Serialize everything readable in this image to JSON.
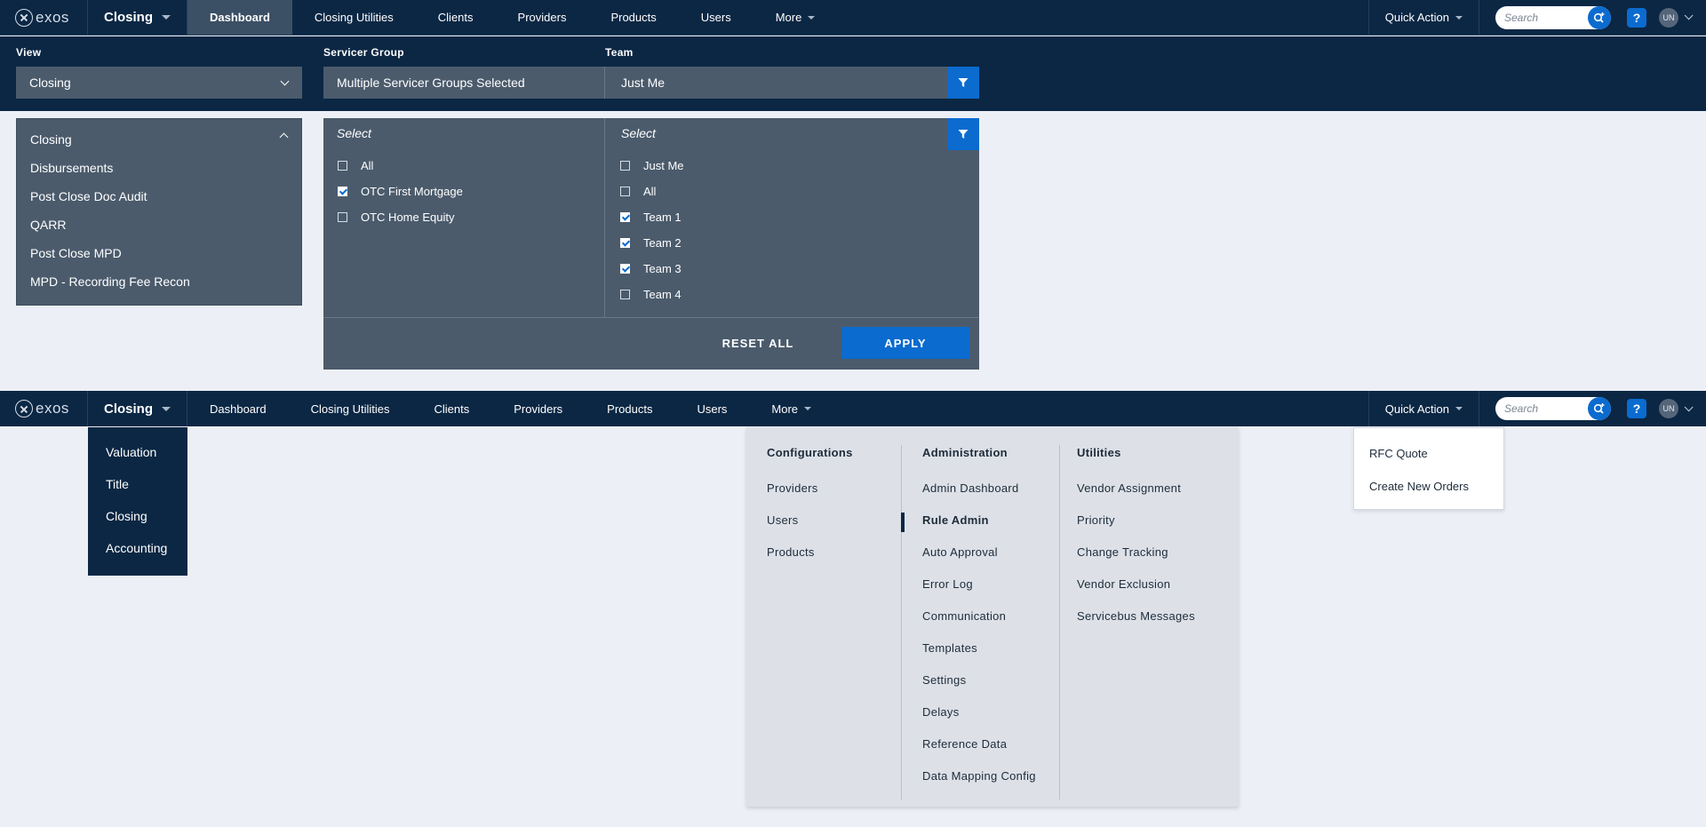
{
  "brand": {
    "logo_text": "exos",
    "app_switch": "Closing"
  },
  "nav": {
    "items": [
      {
        "label": "Dashboard",
        "active": true
      },
      {
        "label": "Closing Utilities"
      },
      {
        "label": "Clients"
      },
      {
        "label": "Providers"
      },
      {
        "label": "Products"
      },
      {
        "label": "Users"
      },
      {
        "label": "More"
      }
    ],
    "quick_action": "Quick Action",
    "search_placeholder": "Search",
    "help": "?",
    "avatar": "UN"
  },
  "filters": {
    "view_label": "View",
    "view_value": "Closing",
    "servicer_label": "Servicer Group",
    "servicer_value": "Multiple Servicer Groups Selected",
    "team_label": "Team",
    "team_value": "Just Me"
  },
  "view_options": [
    "Closing",
    "Disbursements",
    "Post Close Doc Audit",
    "QARR",
    "Post Close MPD",
    "MPD - Recording Fee Recon"
  ],
  "servicer_panel": {
    "heading": "Select",
    "options": [
      {
        "label": "All",
        "checked": false
      },
      {
        "label": "OTC First Mortgage",
        "checked": true
      },
      {
        "label": "OTC Home Equity",
        "checked": false
      }
    ]
  },
  "team_panel": {
    "heading": "Select",
    "options": [
      {
        "label": "Just Me",
        "checked": false
      },
      {
        "label": "All",
        "checked": false
      },
      {
        "label": "Team 1",
        "checked": true
      },
      {
        "label": "Team 2",
        "checked": true
      },
      {
        "label": "Team 3",
        "checked": true
      },
      {
        "label": "Team 4",
        "checked": false
      }
    ]
  },
  "actions": {
    "reset": "RESET ALL",
    "apply": "APPLY"
  },
  "app_menu": [
    "Valuation",
    "Title",
    "Closing",
    "Accounting"
  ],
  "more_menu": {
    "configurations": {
      "title": "Configurations",
      "links": [
        "Providers",
        "Users",
        "Products"
      ]
    },
    "administration": {
      "title": "Administration",
      "links": [
        "Admin Dashboard",
        "Rule Admin",
        "Auto Approval",
        "Error Log",
        "Communication",
        "Templates",
        "Settings",
        "Delays",
        "Reference Data",
        "Data Mapping Config"
      ],
      "selected": "Rule Admin"
    },
    "utilities": {
      "title": "Utilities",
      "links": [
        "Vendor Assignment",
        "Priority",
        "Change Tracking",
        "Vendor Exclusion",
        "Servicebus Messages"
      ]
    }
  },
  "quick_action_menu": [
    "RFC Quote",
    "Create New Orders"
  ],
  "colors": {
    "navy": "#0b2744",
    "accent_blue": "#0b6bcf",
    "panel_gray": "#4b5b6c",
    "page_bg": "#eceff6"
  }
}
